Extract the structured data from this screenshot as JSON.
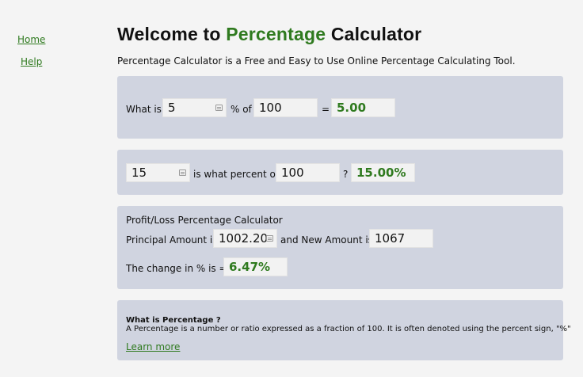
{
  "nav": {
    "home": "Home",
    "help": "Help"
  },
  "header": {
    "title_prefix": "Welcome to ",
    "title_accent": "Percentage",
    "title_suffix": " Calculator",
    "subtitle": "Percentage Calculator is a Free and Easy to Use Online Percentage Calculating Tool."
  },
  "calc1": {
    "label_what_is": "What is",
    "percent_value": "5",
    "label_percent_of": "% of",
    "base_value": "100",
    "label_equals": "=",
    "result": "5.00"
  },
  "calc2": {
    "part_value": "15",
    "label_is_what_percent_of": "is what percent of",
    "whole_value": "100",
    "label_question": "?",
    "result": "15.00%"
  },
  "profit_loss": {
    "title": "Profit/Loss Percentage Calculator",
    "label_principal": "Principal Amount is",
    "principal_value": "1002.20",
    "label_new_amount": "and New Amount is",
    "new_amount_value": "1067",
    "label_change": "The change in % is =",
    "result": "6.47%"
  },
  "info": {
    "heading": "What is Percentage ?",
    "description": "A Percentage is a number or ratio expressed as a fraction of 100. It is often denoted using the percent sign, \"%\"",
    "learn_more": "Learn more"
  },
  "colors": {
    "accent": "#2f7a1f",
    "panel": "#d0d4e0",
    "background": "#f4f4f4"
  }
}
